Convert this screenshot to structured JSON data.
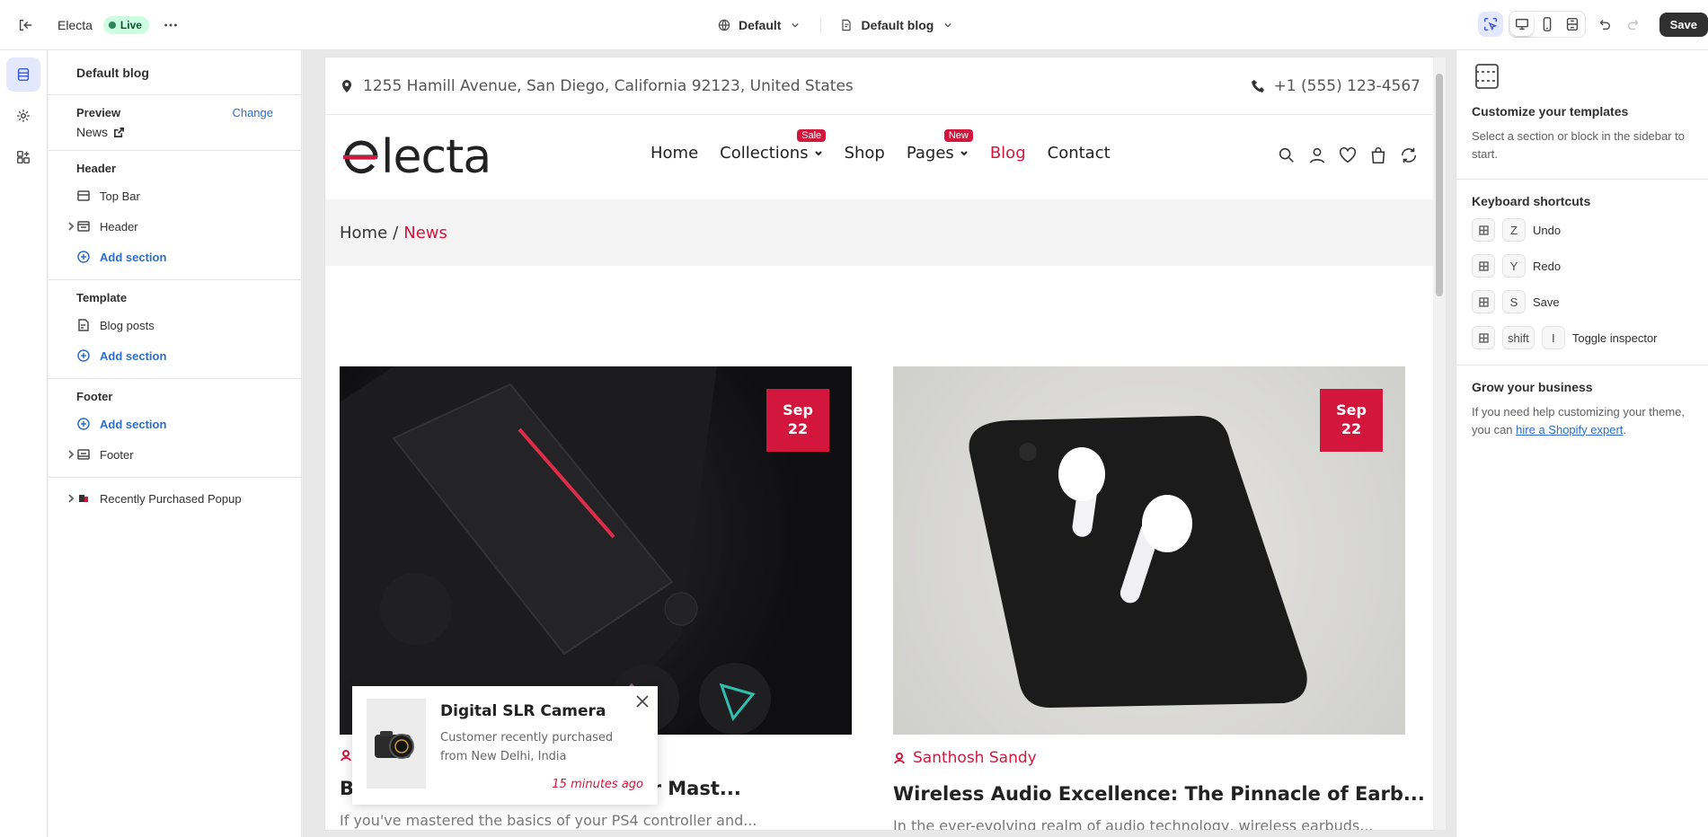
{
  "topbar": {
    "store_name": "Electa",
    "status": "Live",
    "theme_select": "Default",
    "template_select": "Default blog",
    "save_label": "Save"
  },
  "sidebar": {
    "title": "Default blog",
    "preview_label": "Preview",
    "change_label": "Change",
    "preview_value": "News",
    "groups": [
      {
        "title": "Header",
        "items": [
          "Top Bar",
          "Header"
        ],
        "add_label": "Add section"
      },
      {
        "title": "Template",
        "items": [
          "Blog posts"
        ],
        "add_label": "Add section"
      },
      {
        "title": "Footer",
        "items": [
          "Footer"
        ],
        "add_label": "Add section"
      }
    ],
    "extra_item": "Recently Purchased Popup"
  },
  "store": {
    "address": "1255 Hamill Avenue, San Diego, California 92123, United States",
    "phone": "+1 (555) 123-4567",
    "logo": "electa",
    "nav": [
      {
        "label": "Home"
      },
      {
        "label": "Collections",
        "badge": "Sale"
      },
      {
        "label": "Shop"
      },
      {
        "label": "Pages",
        "badge": "New"
      },
      {
        "label": "Blog"
      },
      {
        "label": "Contact"
      }
    ],
    "breadcrumb_home": "Home",
    "breadcrumb_sep": "/",
    "breadcrumb_current": "News",
    "posts": [
      {
        "date_month": "Sep",
        "date_day": "22",
        "author": "",
        "title": "B… ques for Mast...",
        "title_visible": "ques for Mast...",
        "excerpt": "If you've mastered the basics of your PS4 controller and..."
      },
      {
        "date_month": "Sep",
        "date_day": "22",
        "author": "Santhosh Sandy",
        "title": "Wireless Audio Excellence: The Pinnacle of Earb...",
        "excerpt": "In the ever-evolving realm of audio technology, wireless earbuds..."
      }
    ],
    "popup": {
      "title": "Digital SLR Camera",
      "desc_line1": "Customer recently purchased",
      "desc_line2": "from New Delhi, India",
      "time": "15 minutes ago"
    }
  },
  "rpanel": {
    "title": "Customize your templates",
    "desc": "Select a section or block in the sidebar to start.",
    "shortcuts_title": "Keyboard shortcuts",
    "shortcuts": [
      {
        "key": "Z",
        "label": "Undo"
      },
      {
        "key": "Y",
        "label": "Redo"
      },
      {
        "key": "S",
        "label": "Save"
      },
      {
        "key": "shift",
        "key2": "I",
        "label": "Toggle inspector"
      }
    ],
    "grow_title": "Grow your business",
    "grow_desc": "If you need help customizing your theme, you can",
    "grow_link": "hire a Shopify expert",
    "grow_end": "."
  },
  "colors": {
    "accent": "#d3163c",
    "editor_link": "#2c6ecb",
    "live_bg": "#cdfee1"
  }
}
